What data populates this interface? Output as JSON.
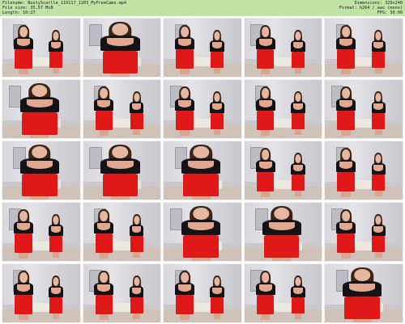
{
  "header": {
    "filename": "Filename: BustyScarlle_110117_1203_MyFreeCams.mp4",
    "filesize": "File size: 35.57 MiB",
    "length": "Length: 10:27",
    "dimensions": "Dimensions: 320x240",
    "format": "Format: h264 / aac (mono)",
    "fps": "FPS: 30.00"
  },
  "colors": {
    "header_bg": "#bfe3a5",
    "skirt": "#e01818",
    "top": "#141418"
  },
  "thumbnails": [
    {
      "variant": "two-figures-standing"
    },
    {
      "variant": "close-up"
    },
    {
      "variant": "two-figures-standing"
    },
    {
      "variant": "two-figures-standing"
    },
    {
      "variant": "two-figures-standing"
    },
    {
      "variant": "close-up"
    },
    {
      "variant": "two-figures-standing"
    },
    {
      "variant": "two-figures-standing"
    },
    {
      "variant": "two-figures-standing"
    },
    {
      "variant": "two-figures-standing"
    },
    {
      "variant": "close-up"
    },
    {
      "variant": "close-up"
    },
    {
      "variant": "close-up"
    },
    {
      "variant": "two-figures-standing"
    },
    {
      "variant": "two-figures-standing"
    },
    {
      "variant": "two-figures-standing"
    },
    {
      "variant": "two-figures-standing"
    },
    {
      "variant": "close-up"
    },
    {
      "variant": "close-up"
    },
    {
      "variant": "two-figures-standing"
    },
    {
      "variant": "two-figures-standing"
    },
    {
      "variant": "two-figures-standing"
    },
    {
      "variant": "two-figures-standing"
    },
    {
      "variant": "two-figures-standing"
    },
    {
      "variant": "close-up"
    }
  ]
}
